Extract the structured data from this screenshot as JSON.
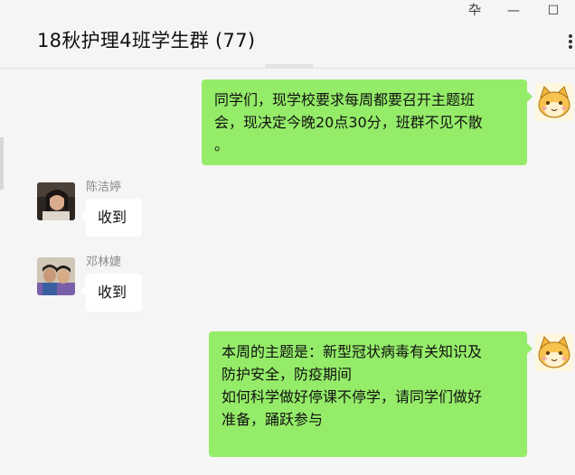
{
  "window": {
    "title": "18秋护理4班学生群 (77)",
    "pin_icon": "pin-icon",
    "pin_glyph": "卆",
    "minimize_glyph": "—",
    "maximize_glyph": "☐"
  },
  "messages": [
    {
      "direction": "outgoing",
      "lines": [
        "同学们，现学校要求每周都要召开主题班",
        "会，现决定今晚20点30分，班群不见不散",
        "。"
      ]
    },
    {
      "direction": "incoming",
      "sender": "陈洁婷",
      "text": "收到"
    },
    {
      "direction": "incoming",
      "sender": "邓林婕",
      "text": "收到"
    },
    {
      "direction": "outgoing",
      "lines": [
        "本周的主题是：新型冠状病毒有关知识及",
        "防护安全，防疫期间",
        "如何科学做好停课不停学，请同学们做好",
        "准备，踊跃参与"
      ]
    }
  ],
  "colors": {
    "outgoing_bubble": "#95ec69",
    "incoming_bubble": "#ffffff",
    "background": "#f5f5f5"
  }
}
